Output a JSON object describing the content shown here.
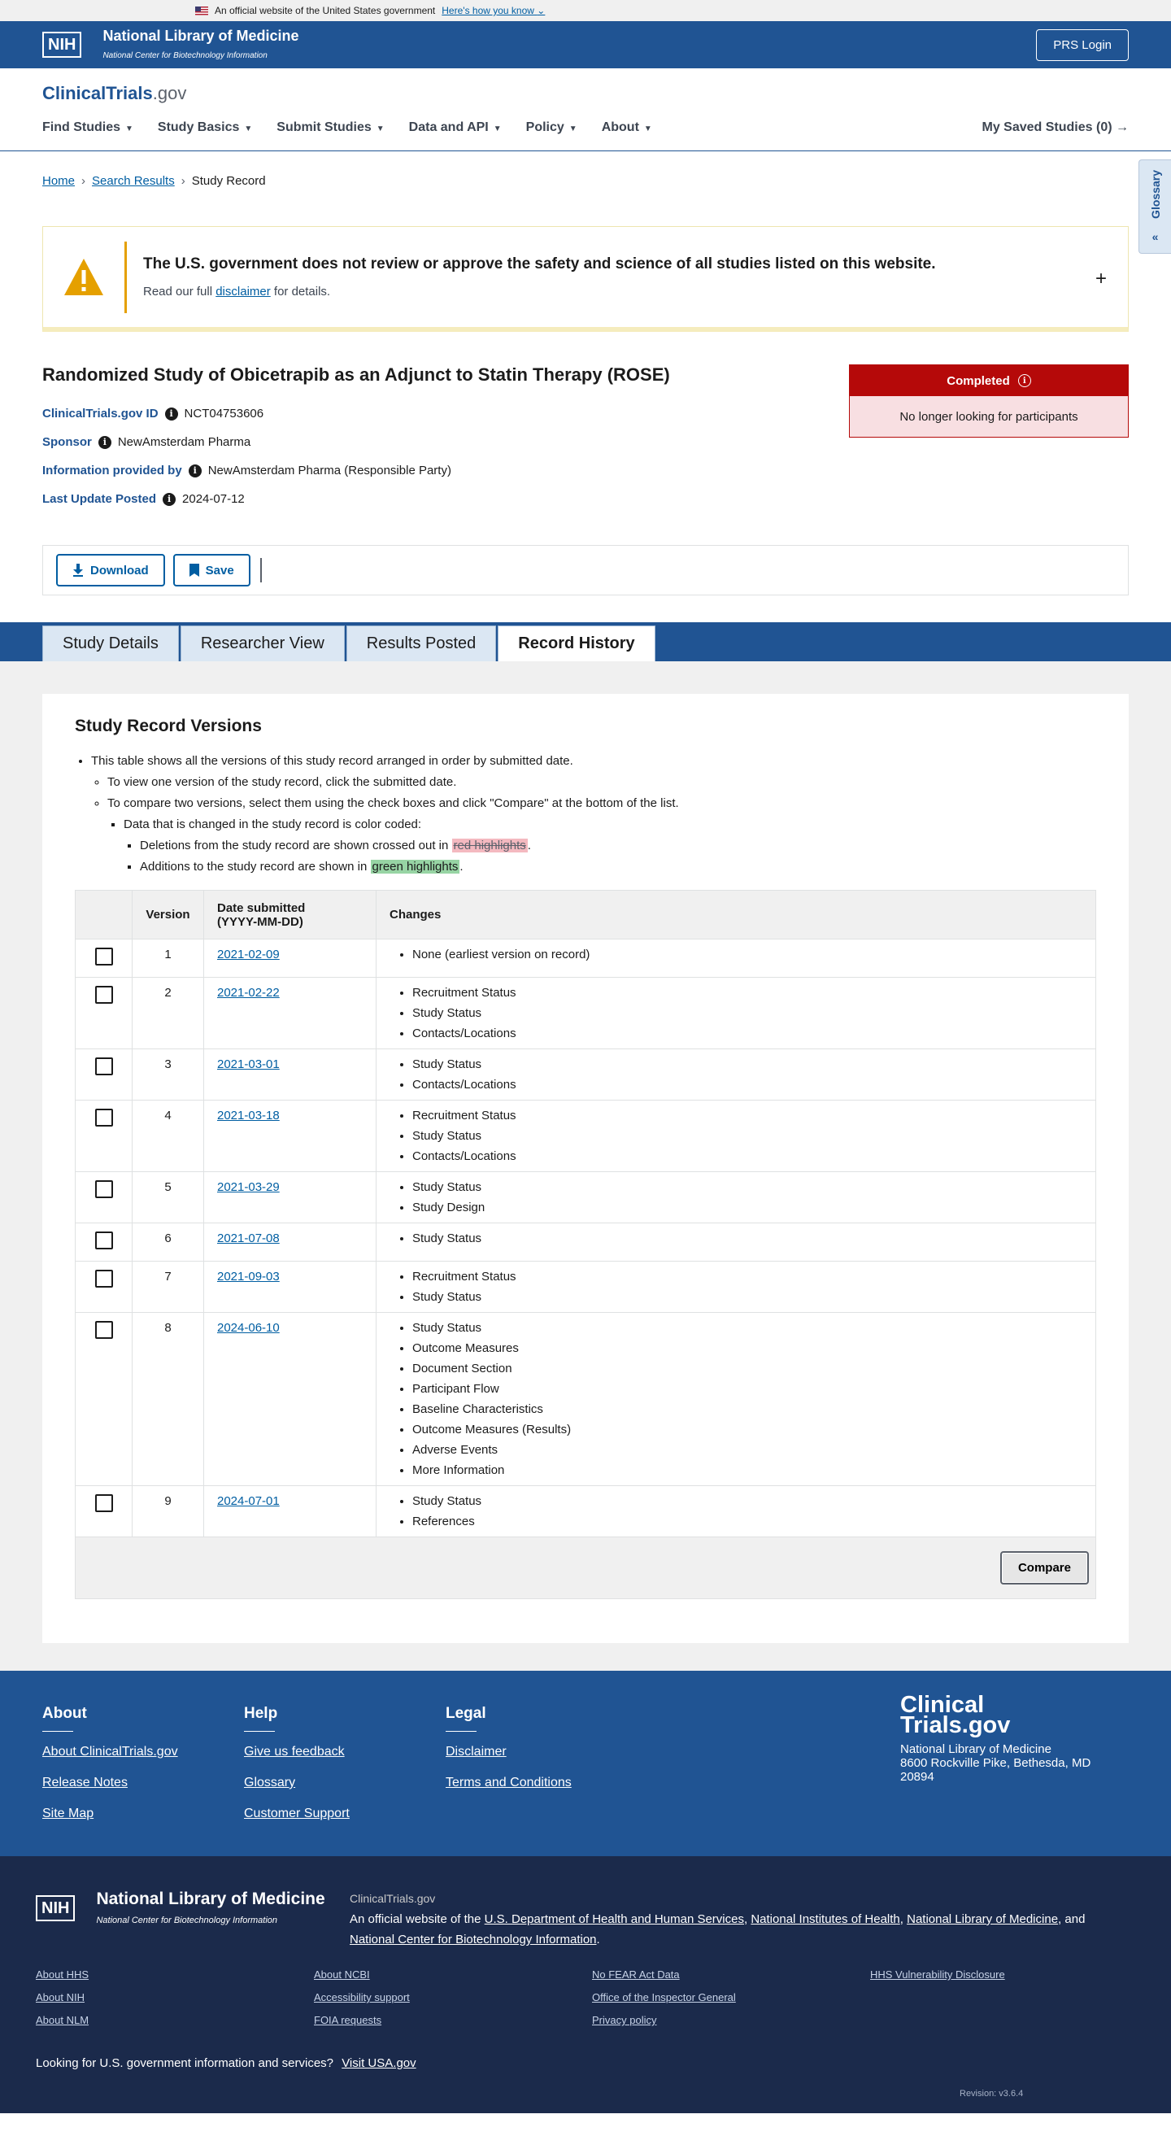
{
  "gov_banner": {
    "text": "An official website of the United States government",
    "link": "Here's how you know"
  },
  "nih_header": {
    "logo_box": "NIH",
    "logo_line1": "National Library of Medicine",
    "logo_line2": "National Center for Biotechnology Information",
    "login_label": "PRS Login"
  },
  "site": {
    "logo_main": "ClinicalTrials",
    "logo_suffix": ".gov",
    "nav": [
      "Find Studies",
      "Study Basics",
      "Submit Studies",
      "Data and API",
      "Policy",
      "About"
    ],
    "saved_studies": "My Saved Studies (0)"
  },
  "breadcrumb": {
    "home": "Home",
    "search": "Search Results",
    "current": "Study Record"
  },
  "glossary_label": "Glossary",
  "alert": {
    "title": "The U.S. government does not review or approve the safety and science of all studies listed on this website.",
    "prefix": "Read our full ",
    "link": "disclaimer",
    "suffix": " for details."
  },
  "study": {
    "title": "Randomized Study of Obicetrapib as an Adjunct to Statin Therapy (ROSE)",
    "id_label": "ClinicalTrials.gov ID",
    "id_value": "NCT04753606",
    "sponsor_label": "Sponsor",
    "sponsor_value": "NewAmsterdam Pharma",
    "info_label": "Information provided by",
    "info_value": "NewAmsterdam Pharma (Responsible Party)",
    "update_label": "Last Update Posted",
    "update_value": "2024-07-12",
    "status": "Completed",
    "status_detail": "No longer looking for participants"
  },
  "actions": {
    "download": "Download",
    "save": "Save"
  },
  "tabs": [
    "Study Details",
    "Researcher View",
    "Results Posted",
    "Record History"
  ],
  "versions": {
    "heading": "Study Record Versions",
    "intro": "This table shows all the versions of this study record arranged in order by submitted date.",
    "view_one": "To view one version of the study record, click the submitted date.",
    "compare_two": "To compare two versions, select them using the check boxes and click \"Compare\" at the bottom of the list.",
    "color_coded": "Data that is changed in the study record is color coded:",
    "deletions_prefix": "Deletions from the study record are shown crossed out in ",
    "deletions_hl": "red highlights",
    "additions_prefix": "Additions to the study record are shown in ",
    "additions_hl": "green highlights",
    "period": ".",
    "col_version": "Version",
    "col_date_1": "Date submitted",
    "col_date_2": "(YYYY-MM-DD)",
    "col_changes": "Changes",
    "compare_label": "Compare",
    "rows": [
      {
        "version": "1",
        "date": "2021-02-09",
        "changes": [
          "None (earliest version on record)"
        ]
      },
      {
        "version": "2",
        "date": "2021-02-22",
        "changes": [
          "Recruitment Status",
          "Study Status",
          "Contacts/Locations"
        ]
      },
      {
        "version": "3",
        "date": "2021-03-01",
        "changes": [
          "Study Status",
          "Contacts/Locations"
        ]
      },
      {
        "version": "4",
        "date": "2021-03-18",
        "changes": [
          "Recruitment Status",
          "Study Status",
          "Contacts/Locations"
        ]
      },
      {
        "version": "5",
        "date": "2021-03-29",
        "changes": [
          "Study Status",
          "Study Design"
        ]
      },
      {
        "version": "6",
        "date": "2021-07-08",
        "changes": [
          "Study Status"
        ]
      },
      {
        "version": "7",
        "date": "2021-09-03",
        "changes": [
          "Recruitment Status",
          "Study Status"
        ]
      },
      {
        "version": "8",
        "date": "2024-06-10",
        "changes": [
          "Study Status",
          "Outcome Measures",
          "Document Section",
          "Participant Flow",
          "Baseline Characteristics",
          "Outcome Measures (Results)",
          "Adverse Events",
          "More Information"
        ]
      },
      {
        "version": "9",
        "date": "2024-07-01",
        "changes": [
          "Study Status",
          "References"
        ]
      }
    ]
  },
  "footer": {
    "about": {
      "heading": "About",
      "links": [
        "About ClinicalTrials.gov",
        "Release Notes",
        "Site Map"
      ]
    },
    "help": {
      "heading": "Help",
      "links": [
        "Give us feedback",
        "Glossary",
        "Customer Support"
      ]
    },
    "legal": {
      "heading": "Legal",
      "links": [
        "Disclaimer",
        "Terms and Conditions"
      ]
    },
    "address": {
      "logo_1": "Clinical",
      "logo_2": "Trials.gov",
      "line1": "National Library of Medicine",
      "line2": "8600 Rockville Pike, Bethesda, MD",
      "line3": "20894"
    }
  },
  "footer2": {
    "site_name": "ClinicalTrials.gov",
    "official_prefix": "An official website of the ",
    "hhs": "U.S. Department of Health and Human Services",
    "nih": "National Institutes of Health",
    "nlm": "National Library of Medicine",
    "ncbi": "National Center for Biotechnology Information",
    "comma": ", ",
    "and_word": ", and ",
    "period": ".",
    "links": [
      "About HHS",
      "About NCBI",
      "No FEAR Act Data",
      "HHS Vulnerability Disclosure",
      "About NIH",
      "Accessibility support",
      "Office of the Inspector General",
      "",
      "About NLM",
      "FOIA requests",
      "Privacy policy",
      ""
    ],
    "question": "Looking for U.S. government information and services?",
    "usa_link": "Visit USA.gov",
    "revision": "Revision: v3.6.4"
  }
}
